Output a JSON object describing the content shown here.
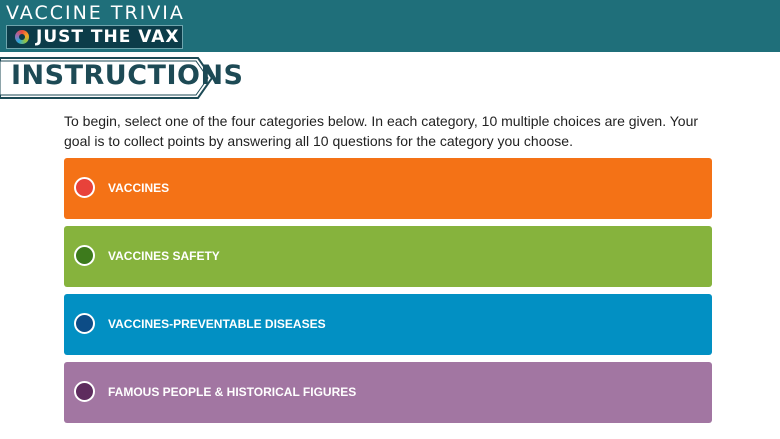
{
  "header": {
    "app_title": "VACCINE TRIVIA",
    "logo_text": "JUST THE VAX",
    "background_color": "#1f6f7a"
  },
  "instructions": {
    "heading": "INSTRUCTIONS",
    "text": "To begin, select one of the four categories below. In each category, 10 multiple choices are given. Your goal is to collect points by answering all 10 questions for the category you choose."
  },
  "categories": [
    {
      "label": "VACCINES",
      "color": "#f47216",
      "radio_color": "#e8423a"
    },
    {
      "label": "VACCINES SAFETY",
      "color": "#86b33d",
      "radio_color": "#3d7a1c"
    },
    {
      "label": "VACCINES-PREVENTABLE DISEASES",
      "color": "#0290c3",
      "radio_color": "#0d4c86"
    },
    {
      "label": "FAMOUS PEOPLE & HISTORICAL FIGURES",
      "color": "#a276a2",
      "radio_color": "#5e2c5e"
    }
  ]
}
